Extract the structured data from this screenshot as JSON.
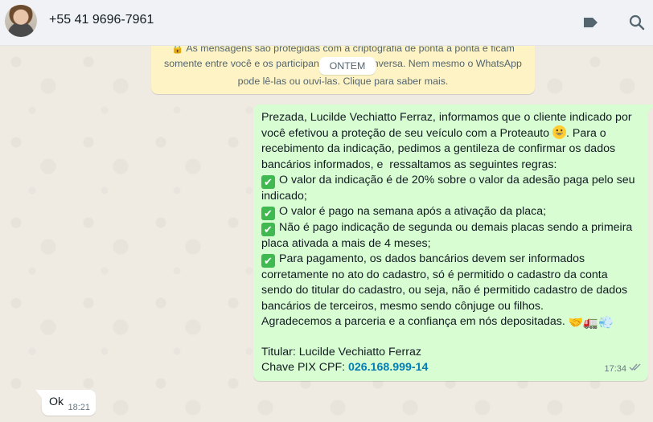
{
  "header": {
    "contact_name": "+55 41 9696-7961"
  },
  "system_notice": {
    "line1": "🔒 As mensagens são protegidas com a criptografia de ponta a ponta e ficam",
    "line2": "somente entre você e os participantes desta conversa. Nem mesmo o WhatsApp",
    "line3": "pode lê-las ou ouvi-las. Clique para saber mais."
  },
  "date_chip": "ONTEM",
  "outgoing_message": {
    "intro": "Prezada, Lucilde Vechiatto Ferraz, informamos que o cliente indicado por você efetivou a proteção de seu veículo com a Proteauto",
    "intro_end": ". Para o recebimento da indicação, pedimos a gentileza de confirmar os dados bancários informados, e  ressaltamos as seguintes regras:",
    "rules": [
      "O valor da indicação é de 20% sobre o valor da adesão paga pelo seu indicado;",
      "O valor é pago na semana após a ativação da placa;",
      "Não é pago indicação de segunda ou demais placas sendo a primeira placa ativada a mais de 4 meses;",
      "Para pagamento, os dados bancários devem ser informados corretamente no ato do cadastro, só é permitido o cadastro da conta sendo do titular do cadastro, ou seja, não é permitido cadastro de dados bancários de terceiros, mesmo sendo cônjuge ou filhos."
    ],
    "closing": "Agradecemos a parceria e a confiança em nós depositadas.",
    "closing_emojis": "🤝🚛💨",
    "titular": "Titular: Lucilde Vechiatto Ferraz",
    "pix_label": "Chave PIX CPF: ",
    "pix_value": "026.168.999-14",
    "time": "17:34"
  },
  "incoming_message": {
    "text": "Ok",
    "time": "18:21"
  },
  "colors": {
    "outgoing_bubble": "#d9fdd3",
    "incoming_bubble": "#ffffff",
    "notice_bg": "#fdf3c5",
    "link": "#027eb5",
    "check_green": "#3fb950"
  },
  "icons": {
    "label": "label-tag-icon",
    "search": "search-icon",
    "read_receipt": "double-check-icon",
    "rule_check": "check-mark-button-icon"
  }
}
